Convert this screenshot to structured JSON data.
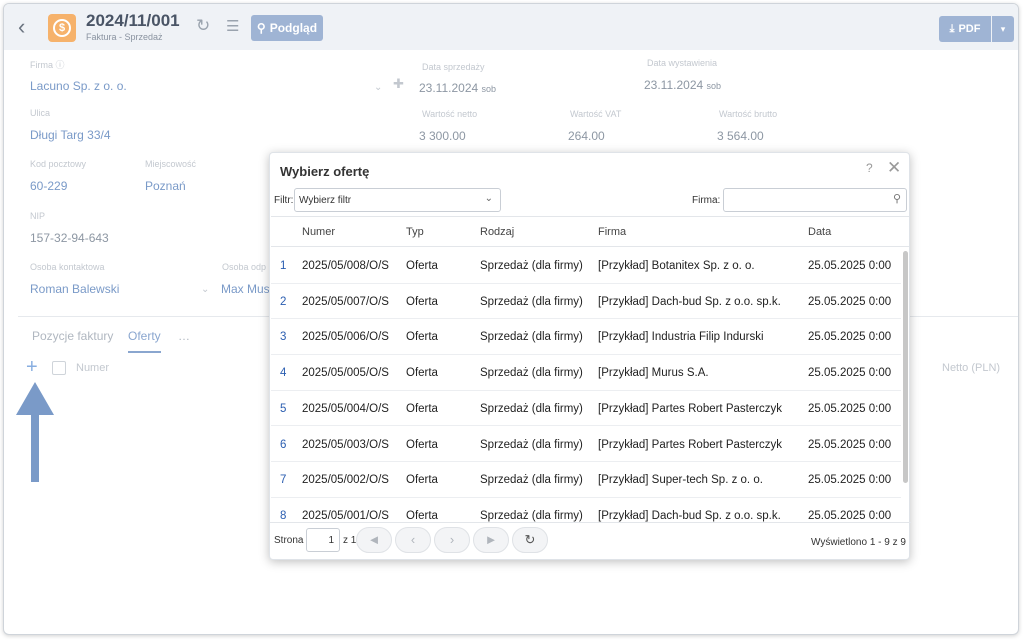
{
  "header": {
    "title": "2024/11/001",
    "subtitle": "Faktura - Sprzedaż",
    "preview_label": "Podgląd",
    "pdf_label": "PDF"
  },
  "form": {
    "firma_label": "Firma ⓘ",
    "firma_value": "Lacuno Sp. z o. o.",
    "data_sprzedazy_label": "Data sprzedaży",
    "data_sprzedazy_value": "23.11.2024",
    "data_sprzedazy_day": "sob",
    "data_wystawienia_label": "Data wystawienia",
    "data_wystawienia_value": "23.11.2024",
    "data_wystawienia_day": "sob",
    "ulica_label": "Ulica",
    "ulica_value": "Długi Targ 33/4",
    "netto_label": "Wartość netto",
    "netto_value": "3 300.00",
    "vat_label": "Wartość VAT",
    "vat_value": "264.00",
    "brutto_label": "Wartość brutto",
    "brutto_value": "3 564.00",
    "kod_label": "Kod pocztowy",
    "kod_value": "60-229",
    "miejscowosc_label": "Miejscowość",
    "miejscowosc_value": "Poznań",
    "nip_label": "NIP",
    "nip_value": "157-32-94-643",
    "osoba_label": "Osoba kontaktowa",
    "osoba_value": "Roman Balewski",
    "osoba2_label": "Osoba odp",
    "osoba2_value": "Max Mus"
  },
  "tabs": {
    "pozycje": "Pozycje faktury",
    "oferty": "Oferty",
    "more": "…"
  },
  "items_table": {
    "numer_header": "Numer",
    "netto_header": "Netto (PLN)"
  },
  "modal": {
    "title": "Wybierz ofertę",
    "help": "?",
    "close": "✕",
    "filter_label": "Filtr:",
    "filter_value": "Wybierz filtr",
    "firma_label": "Firma:",
    "columns": [
      "Numer",
      "Typ",
      "Rodzaj",
      "Firma",
      "Data"
    ],
    "rows": [
      {
        "idx": "1",
        "numer": "2025/05/008/O/S",
        "typ": "Oferta",
        "rodzaj": "Sprzedaż (dla firmy)",
        "firma": "[Przykład] Botanitex Sp. z o. o.",
        "data": "25.05.2025 0:00"
      },
      {
        "idx": "2",
        "numer": "2025/05/007/O/S",
        "typ": "Oferta",
        "rodzaj": "Sprzedaż (dla firmy)",
        "firma": "[Przykład] Dach-bud Sp. z o.o. sp.k.",
        "data": "25.05.2025 0:00"
      },
      {
        "idx": "3",
        "numer": "2025/05/006/O/S",
        "typ": "Oferta",
        "rodzaj": "Sprzedaż (dla firmy)",
        "firma": "[Przykład] Industria Filip Indurski",
        "data": "25.05.2025 0:00"
      },
      {
        "idx": "4",
        "numer": "2025/05/005/O/S",
        "typ": "Oferta",
        "rodzaj": "Sprzedaż (dla firmy)",
        "firma": "[Przykład] Murus S.A.",
        "data": "25.05.2025 0:00"
      },
      {
        "idx": "5",
        "numer": "2025/05/004/O/S",
        "typ": "Oferta",
        "rodzaj": "Sprzedaż (dla firmy)",
        "firma": "[Przykład] Partes Robert Pasterczyk",
        "data": "25.05.2025 0:00"
      },
      {
        "idx": "6",
        "numer": "2025/05/003/O/S",
        "typ": "Oferta",
        "rodzaj": "Sprzedaż (dla firmy)",
        "firma": "[Przykład] Partes Robert Pasterczyk",
        "data": "25.05.2025 0:00"
      },
      {
        "idx": "7",
        "numer": "2025/05/002/O/S",
        "typ": "Oferta",
        "rodzaj": "Sprzedaż (dla firmy)",
        "firma": "[Przykład] Super-tech Sp. z o. o.",
        "data": "25.05.2025 0:00"
      },
      {
        "idx": "8",
        "numer": "2025/05/001/O/S",
        "typ": "Oferta",
        "rodzaj": "Sprzedaż (dla firmy)",
        "firma": "[Przykład] Dach-bud Sp. z o.o. sp.k.",
        "data": "25.05.2025 0:00"
      }
    ],
    "pager": {
      "strona_label": "Strona",
      "page": "1",
      "of_label": "z 1",
      "shown": "Wyświetlono 1 - 9 z 9"
    }
  },
  "colors": {
    "accent": "#9fb4d4",
    "link": "#2a5db0",
    "arrow": "#7a9ac8"
  }
}
